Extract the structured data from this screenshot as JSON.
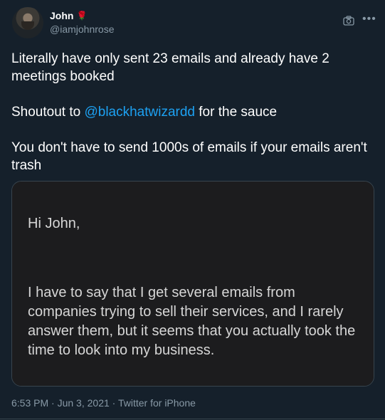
{
  "author": {
    "name": "John",
    "emoji": "🌹",
    "handle": "@iamjohnrose"
  },
  "tweet": {
    "line1": "Literally have only sent 23 emails and already have 2 meetings booked",
    "shoutout_prefix": "Shoutout to ",
    "mention": "@blackhatwizardd",
    "shoutout_suffix": " for the sauce",
    "line3": "You don't have to send 1000s of emails if your emails aren't trash"
  },
  "email_image": {
    "greeting": "Hi John,",
    "body": "I have to say that I get several emails from companies trying to sell their services, and I rarely answer them, but it seems that you actually took the time to look into my business."
  },
  "meta": {
    "time": "6:53 PM",
    "sep1": " · ",
    "date": "Jun 3, 2021",
    "sep2": " · ",
    "source": "Twitter for iPhone"
  },
  "icons": {
    "camera": "camera-icon",
    "more": "more-icon",
    "rose": "rose-icon"
  },
  "colors": {
    "background": "#15202b",
    "text": "#ffffff",
    "secondary": "#8899a6",
    "link": "#1da1f2",
    "card_border": "#38444d"
  }
}
